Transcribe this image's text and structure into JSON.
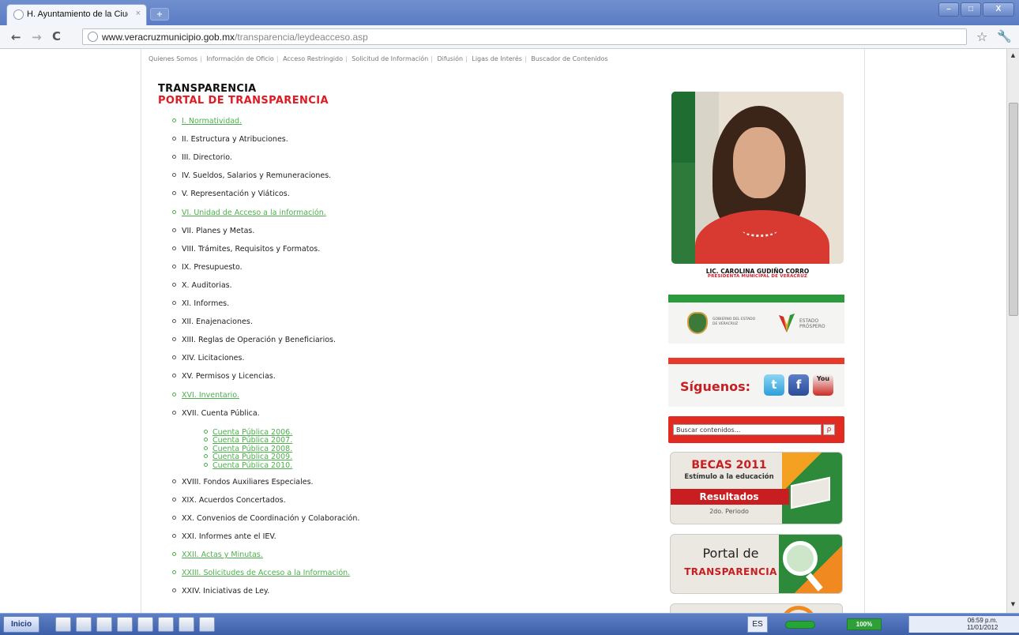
{
  "browser": {
    "tab_title": "H. Ayuntamiento de la Ciudad",
    "tab_close": "×",
    "new_tab": "+",
    "url_host": "www.veracruzmunicipio.gob.mx",
    "url_path": "/transparencia/leydeacceso.asp",
    "back": "←",
    "forward": "→",
    "reload": "C",
    "star": "☆",
    "wrench": "🔧",
    "win_min": "–",
    "win_max": "□",
    "win_close": "X"
  },
  "topnav": [
    "Quienes Somos",
    "Información de Oficio",
    "Acceso Restringido",
    "Solicitud de Información",
    "Difusión",
    "Ligas de Interés",
    "Buscador de Contenidos"
  ],
  "heading": "TRANSPARENCIA",
  "subheading": "PORTAL DE TRANSPARENCIA",
  "items": [
    {
      "label": "I. Normatividad.",
      "link": true
    },
    {
      "label": "II. Estructura y Atribuciones.",
      "link": false
    },
    {
      "label": "III. Directorio.",
      "link": false
    },
    {
      "label": "IV. Sueldos, Salarios y Remuneraciones.",
      "link": false
    },
    {
      "label": "V. Representación y Viáticos.",
      "link": false
    },
    {
      "label": "VI. Unidad de Acceso a la información.",
      "link": true
    },
    {
      "label": "VII. Planes y Metas.",
      "link": false
    },
    {
      "label": "VIII. Trámites, Requisitos y Formatos.",
      "link": false
    },
    {
      "label": "IX. Presupuesto.",
      "link": false
    },
    {
      "label": "X. Auditorias.",
      "link": false
    },
    {
      "label": "XI. Informes.",
      "link": false
    },
    {
      "label": "XII. Enajenaciones.",
      "link": false
    },
    {
      "label": "XIII. Reglas de Operación y Beneficiarios.",
      "link": false
    },
    {
      "label": "XIV. Licitaciones.",
      "link": false
    },
    {
      "label": "XV. Permisos y Licencias.",
      "link": false
    },
    {
      "label": "XVI. Inventario.",
      "link": true
    },
    {
      "label": "XVII. Cuenta Pública.",
      "link": false
    },
    {
      "label": "XVIII. Fondos Auxiliares Especiales.",
      "link": false
    },
    {
      "label": "XIX. Acuerdos Concertados.",
      "link": false
    },
    {
      "label": "XX. Convenios de Coordinación y Colaboración.",
      "link": false
    },
    {
      "label": "XXI. Informes ante el IEV.",
      "link": false
    },
    {
      "label": "XXII. Actas y Minutas.",
      "link": true
    },
    {
      "label": "XXIII. Solicitudes de Acceso a la Información.",
      "link": true
    },
    {
      "label": "XXIV. Iniciativas de Ley.",
      "link": false
    }
  ],
  "cuenta_publica": [
    "Cuenta Pública 2006.",
    "Cuenta Pública 2007.",
    "Cuenta Pública 2008.",
    "Cuenta Pública 2009.",
    "Cuenta Pública 2010."
  ],
  "mayor": {
    "name": "LIC. CAROLINA GUDIÑO CORRO",
    "title": "PRESIDENTA MUNICIPAL DE VERACRUZ"
  },
  "gov_banner": {
    "gov_text": "GOBIERNO DEL ESTADO DE VERACRUZ",
    "estado": "ESTADO",
    "prospero": "PRÓSPERO"
  },
  "social": {
    "label": "Síguenos:",
    "twitter": "t",
    "facebook": "f",
    "youtube": "You"
  },
  "search": {
    "placeholder": "Buscar contenidos...",
    "button": "ρ"
  },
  "becas": {
    "title": "BECAS 2011",
    "subtitle": "Estímulo a la educación",
    "resultados": "Resultados",
    "periodo": "2do. Periodo"
  },
  "portal": {
    "line1": "Portal de",
    "line2": "TRANSPARENCIA"
  },
  "taskbar": {
    "start": "Inicio",
    "lang": "ES",
    "zoom": "100%",
    "time": "06:59 p.m.",
    "date": "11/01/2012"
  }
}
